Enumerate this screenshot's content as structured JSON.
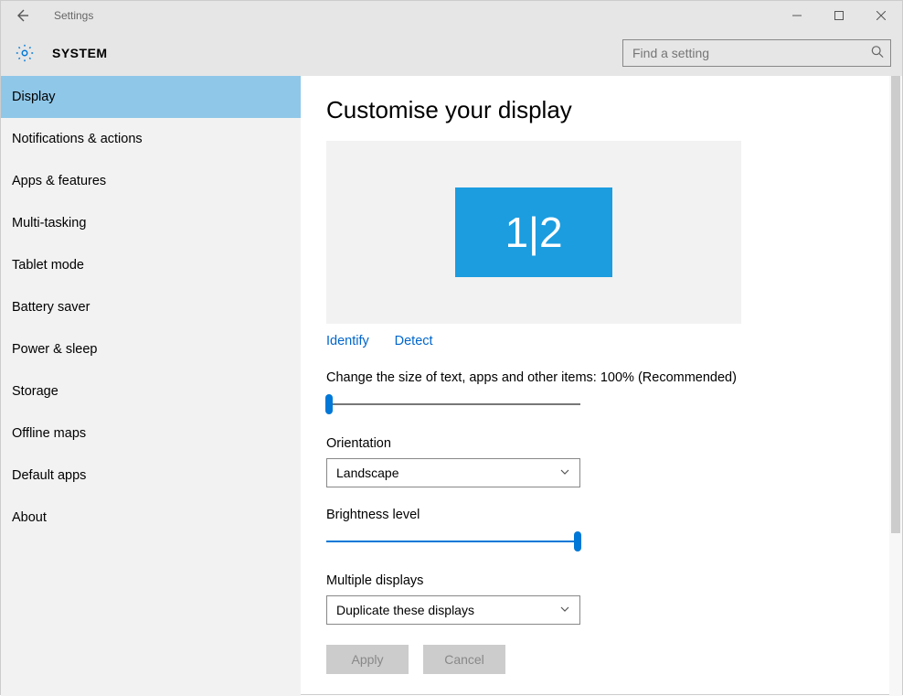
{
  "titlebar": {
    "title": "Settings"
  },
  "header": {
    "system_label": "SYSTEM",
    "search_placeholder": "Find a setting"
  },
  "sidebar": {
    "items": [
      {
        "label": "Display",
        "active": true
      },
      {
        "label": "Notifications & actions"
      },
      {
        "label": "Apps & features"
      },
      {
        "label": "Multi-tasking"
      },
      {
        "label": "Tablet mode"
      },
      {
        "label": "Battery saver"
      },
      {
        "label": "Power & sleep"
      },
      {
        "label": "Storage"
      },
      {
        "label": "Offline maps"
      },
      {
        "label": "Default apps"
      },
      {
        "label": "About"
      }
    ]
  },
  "main": {
    "heading": "Customise your display",
    "monitor_label": "1|2",
    "identify_link": "Identify",
    "detect_link": "Detect",
    "scale_label": "Change the size of text, apps and other items: 100% (Recommended)",
    "scale_value": 0,
    "orientation_label": "Orientation",
    "orientation_value": "Landscape",
    "brightness_label": "Brightness level",
    "brightness_value": 100,
    "multiple_displays_label": "Multiple displays",
    "multiple_displays_value": "Duplicate these displays",
    "apply_label": "Apply",
    "cancel_label": "Cancel"
  }
}
